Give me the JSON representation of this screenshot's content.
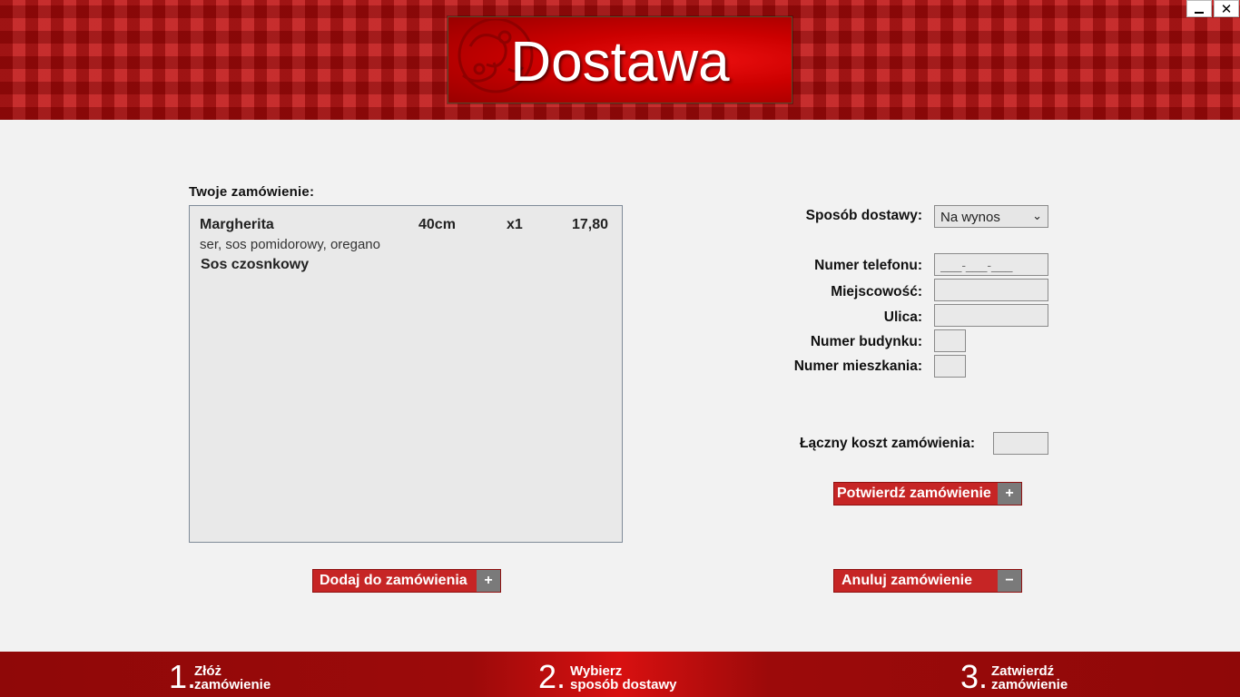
{
  "header": {
    "title": "Dostawa"
  },
  "window": {
    "minimize": "–",
    "close": "✕"
  },
  "order": {
    "label": "Twoje zamówienie:",
    "items": [
      {
        "name": "Margherita",
        "size": "40cm",
        "qty": "x1",
        "price": "17,80",
        "desc": "ser, sos pomidorowy, oregano"
      },
      {
        "name": "Sos czosnkowy"
      }
    ],
    "add_button": {
      "label": "Dodaj do zamówienia",
      "sign": "+"
    }
  },
  "form": {
    "delivery_label": "Sposób dostawy:",
    "delivery_value": "Na wynos",
    "phone_label": "Numer telefonu:",
    "phone_placeholder": "___-___-___",
    "city_label": "Miejscowość:",
    "street_label": "Ulica:",
    "building_label": "Numer budynku:",
    "apartment_label": "Numer mieszkania:",
    "total_label": "Łączny koszt zamówienia:",
    "confirm_button": {
      "label": "Potwierdź zamówienie",
      "sign": "+"
    },
    "cancel_button": {
      "label": "Anuluj zamówienie",
      "sign": "−"
    }
  },
  "footer": {
    "steps": [
      {
        "num": "1.",
        "line1": "Złóż",
        "line2": "zamówienie"
      },
      {
        "num": "2.",
        "line1": "Wybierz",
        "line2": "sposób dostawy"
      },
      {
        "num": "3.",
        "line1": "Zatwierdź",
        "line2": "zamówienie"
      }
    ]
  },
  "colors": {
    "brand_red": "#c62525",
    "footer_red": "#9c0a0a",
    "panel_bg": "#e9e9e9"
  }
}
